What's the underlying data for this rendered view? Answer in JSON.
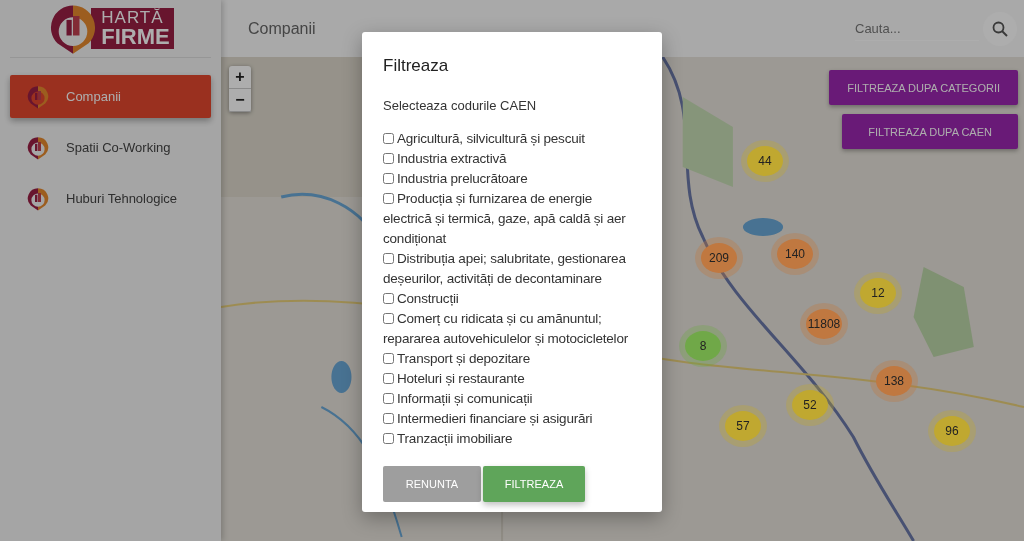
{
  "logo": {
    "line_1": "HARTĂ",
    "line_2": "FIRME"
  },
  "sidebar": {
    "items": [
      {
        "label": "Companii",
        "selected": true
      },
      {
        "label": "Spatii Co-Working",
        "selected": false
      },
      {
        "label": "Huburi Tehnologice",
        "selected": false
      }
    ]
  },
  "header": {
    "title": "Companii",
    "search": {
      "placeholder": "Cauta..."
    }
  },
  "map": {
    "zoom_in": "+",
    "zoom_out": "−",
    "buttons": [
      "FILTREAZA DUPA CATEGORII",
      "FILTREAZA DUPA CAEN"
    ],
    "clusters": [
      {
        "count": "44",
        "color": "#c0a830"
      },
      {
        "count": "209",
        "color": "#c07840"
      },
      {
        "count": "140",
        "color": "#c07840"
      },
      {
        "count": "12",
        "color": "#c0a830"
      },
      {
        "count": "11808",
        "color": "#c07840"
      },
      {
        "count": "8",
        "color": "#70a848"
      },
      {
        "count": "138",
        "color": "#c07840"
      },
      {
        "count": "52",
        "color": "#c0a830"
      },
      {
        "count": "57",
        "color": "#c0a830"
      },
      {
        "count": "96",
        "color": "#c0a830"
      }
    ]
  },
  "dialog": {
    "title": "Filtreaza",
    "subtitle": "Selecteaza codurile CAEN",
    "options": [
      {
        "label": "Agricultură, silvicultură și pescuit",
        "checked": false
      },
      {
        "label": "Industria extractivă",
        "checked": false
      },
      {
        "label": "Industria prelucrătoare",
        "checked": false
      },
      {
        "label": "Producția și furnizarea de energie electrică și termică, gaze, apă caldă și aer condiționat",
        "checked": false
      },
      {
        "label": "Distribuția apei; salubritate, gestionarea deșeurilor, activități de decontaminare",
        "checked": false
      },
      {
        "label": "Construcții",
        "checked": false
      },
      {
        "label": "Comerț cu ridicata și cu amănuntul; repararea autovehiculelor și motocicletelor",
        "checked": false
      },
      {
        "label": "Transport și depozitare",
        "checked": false
      },
      {
        "label": "Hoteluri și restaurante",
        "checked": false
      },
      {
        "label": "Informații și comunicații",
        "checked": false
      },
      {
        "label": "Intermedieri financiare și asigurări",
        "checked": false
      },
      {
        "label": "Tranzacții imobiliare",
        "checked": false
      }
    ],
    "cancel": "RENUNTA",
    "confirm": "FILTREAZA"
  }
}
